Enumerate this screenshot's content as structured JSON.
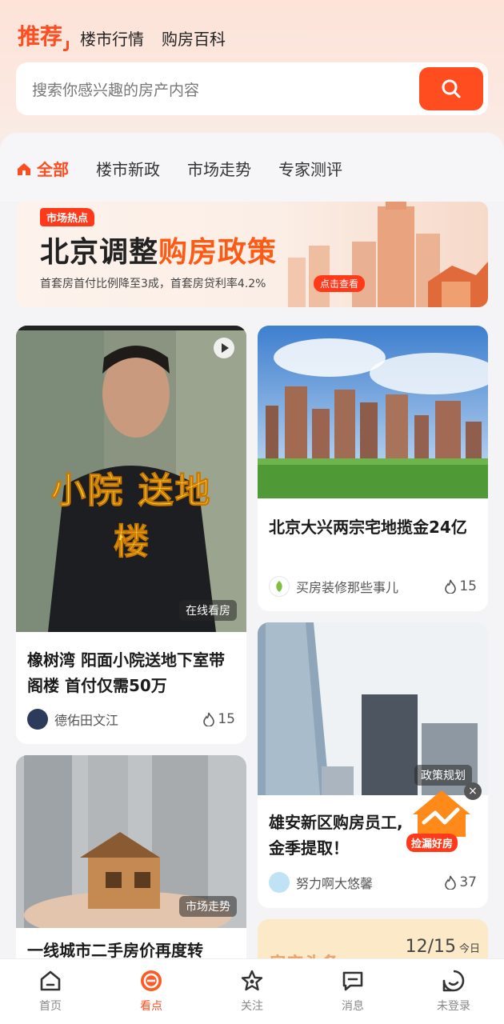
{
  "top_tabs": {
    "active": "推荐",
    "items": [
      "楼市行情",
      "购房百科"
    ]
  },
  "search": {
    "placeholder": "搜索你感兴趣的房产内容"
  },
  "channels": {
    "active": "全部",
    "items": [
      "楼市新政",
      "市场走势",
      "专家测评"
    ]
  },
  "banner": {
    "tag": "市场热点",
    "title_black": "北京调整",
    "title_highlight": "购房政策",
    "subtitle": "首套房首付比例降至3成，首套房贷利率4.2%",
    "cta": "点击查看"
  },
  "cards": [
    {
      "title": "橡树湾 阳面小院送地下室带阁楼 首付仅需50万",
      "author": "德佑田文江",
      "likes": "15",
      "tag": "在线看房",
      "overlay_line1": "小院 送地",
      "overlay_line2": "楼"
    },
    {
      "title": "北京大兴两宗宅地揽金24亿",
      "author": "买房装修那些事儿",
      "likes": "15"
    },
    {
      "title": "雄安新区购房员工,金季提取！",
      "author": "努力啊大悠馨",
      "likes": "37",
      "tag": "政策规划",
      "promo": "捡漏好房"
    },
    {
      "title": "一线城市二手房价再度转",
      "tag": "市场走势"
    },
    {
      "partial_title": "房产头条",
      "date": "12/15",
      "date_note": "今日"
    }
  ],
  "bottom_nav": [
    {
      "label": "首页",
      "icon": "home-icon"
    },
    {
      "label": "看点",
      "icon": "focus-icon"
    },
    {
      "label": "关注",
      "icon": "star-icon"
    },
    {
      "label": "消息",
      "icon": "message-icon"
    },
    {
      "label": "未登录",
      "icon": "profile-icon"
    }
  ],
  "colors": {
    "accent": "#ff4d1f",
    "text": "#1f1f1f",
    "muted": "#888888"
  }
}
